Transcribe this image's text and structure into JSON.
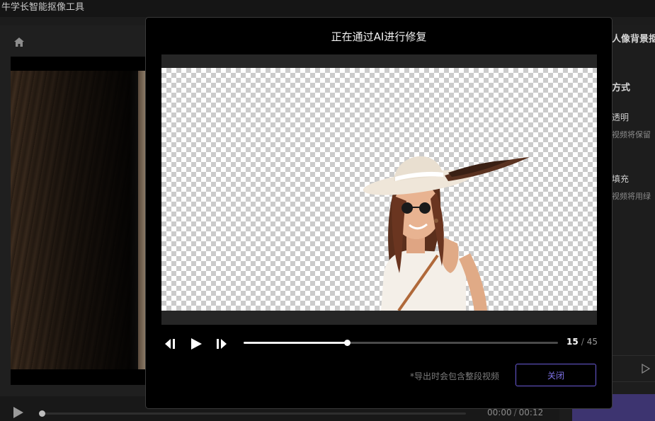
{
  "app": {
    "title": "牛学长智能抠像工具"
  },
  "left_panel": {
    "home_icon": "home-icon",
    "playback": {
      "current_time": "00:00",
      "separator": "/",
      "duration": "00:12"
    }
  },
  "right_panel": {
    "title": "人像背景抠",
    "section_title": "方式",
    "option1_label": "透明",
    "option1_desc": "视频将保留",
    "option2_label": "填充",
    "option2_desc": "视频将用绿"
  },
  "modal": {
    "title": "正在通过AI进行修复",
    "frame_current": "15",
    "frame_separator": "/",
    "frame_total": "45",
    "progress": 0.33,
    "note": "*导出时会包含整段视频",
    "close_label": "关闭"
  },
  "colors": {
    "accent": "#6a5bd6",
    "accent_text": "#7f72e6",
    "export_button": "#3d3470"
  }
}
